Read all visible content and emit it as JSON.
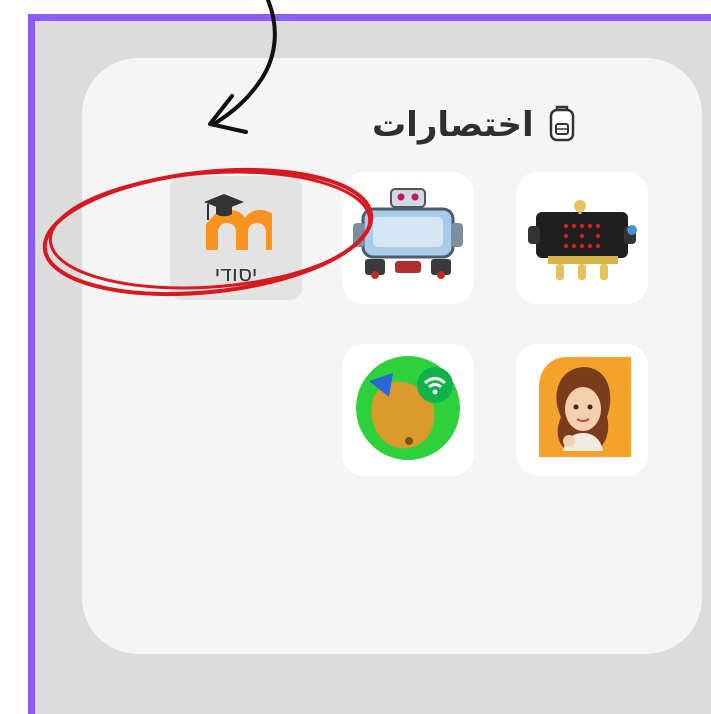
{
  "shortcuts": {
    "title": "اختصارات",
    "icon": "backpack-icon"
  },
  "apps": [
    {
      "id": "microbit",
      "icon": "microbit-robot-icon"
    },
    {
      "id": "robot",
      "icon": "blue-robot-icon"
    },
    {
      "id": "moodle",
      "icon": "moodle-icon",
      "label": "יסודי"
    },
    {
      "id": "character",
      "icon": "cartoon-girl-icon"
    },
    {
      "id": "wifi-app",
      "icon": "puzzle-wifi-icon"
    }
  ],
  "colors": {
    "frame_border": "#8b5cf6",
    "annotation_red": "#d71920",
    "moodle_orange": "#f7931e"
  }
}
